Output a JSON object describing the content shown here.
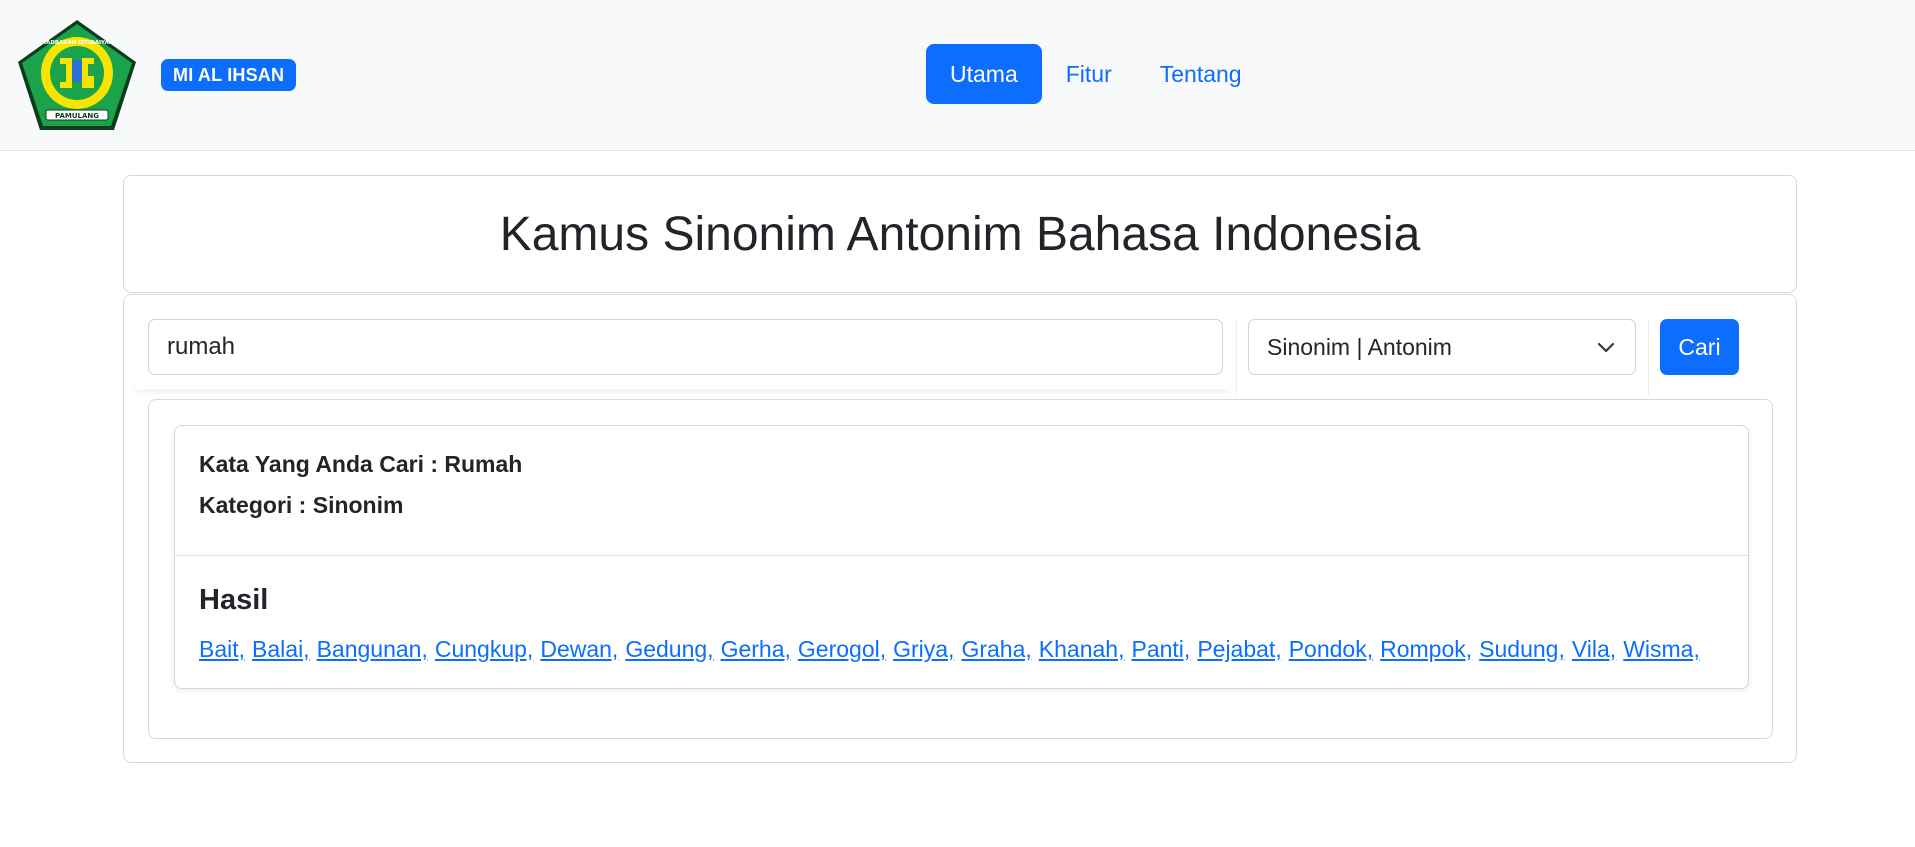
{
  "logo": {
    "top_text": "MADRASAH IBTIDAIYAH",
    "bottom_text": "PAMULANG",
    "colors": {
      "green": "#1aa34a",
      "yellow": "#f7e500",
      "dark": "#0b3d1c"
    }
  },
  "navbar": {
    "brand": "MI AL IHSAN",
    "links": [
      {
        "label": "Utama",
        "active": true
      },
      {
        "label": "Fitur",
        "active": false
      },
      {
        "label": "Tentang",
        "active": false
      }
    ]
  },
  "page": {
    "title": "Kamus Sinonim Antonim Bahasa Indonesia"
  },
  "search": {
    "value": "rumah",
    "select_value": "Sinonim | Antonim",
    "button_label": "Cari"
  },
  "result": {
    "searched_word_line": "Kata Yang Anda Cari : Rumah",
    "category_line": "Kategori : Sinonim",
    "heading": "Hasil",
    "words": [
      "Bait,",
      "Balai,",
      "Bangunan,",
      "Cungkup,",
      "Dewan,",
      "Gedung,",
      "Gerha,",
      "Gerogol,",
      "Griya,",
      "Graha,",
      "Khanah,",
      "Panti,",
      "Pejabat,",
      "Pondok,",
      "Rompok,",
      "Sudung,",
      "Vila,",
      "Wisma,"
    ]
  },
  "colors": {
    "primary": "#0d6efd",
    "navbar_bg": "#f8f9fa",
    "text": "#212529",
    "border": "#d6d9dc"
  }
}
